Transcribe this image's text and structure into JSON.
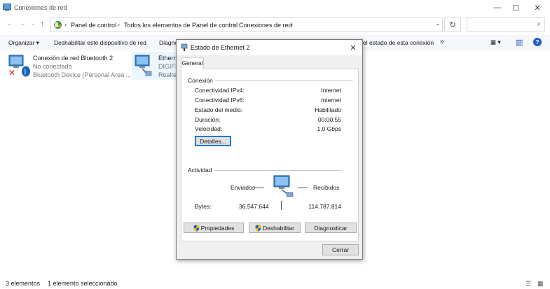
{
  "window": {
    "title": "Conexiones de red",
    "controls": {
      "minimize": "—",
      "maximize": "☐",
      "close": "✕"
    }
  },
  "address": {
    "back": "←",
    "forward": "→",
    "up": "↑",
    "crumbs": [
      "Panel de control",
      "Todos los elementos de Panel de control",
      "Conexiones de red"
    ],
    "separator": "›",
    "dropdown": "⌄",
    "refresh": "↻",
    "search_icon": "⌕"
  },
  "toolbar": {
    "organize": "Organizar ▾",
    "disable": "Deshabilitar este dispositivo de red",
    "diagnose_partial": "Diagno",
    "status_partial": "el estado de esta conexión",
    "more": "»",
    "view": "▦ ▾",
    "pane": "▥",
    "help": "?"
  },
  "connections": [
    {
      "name": "Conexión de red Bluetooth 2",
      "state": "No conectado",
      "device": "Bluetooth Device (Personal Area ..."
    },
    {
      "name": "Etherne",
      "state": "DIGIFIE",
      "device": "Realtek"
    }
  ],
  "statusbar": {
    "count": "3 elementos",
    "selected": "1 elemento seleccionado"
  },
  "dialog": {
    "title": "Estado de Ethernet 2",
    "close": "✕",
    "tab": "General",
    "connection": {
      "heading": "Conexión",
      "rows": [
        {
          "label": "Conectividad IPv4:",
          "value": "Internet"
        },
        {
          "label": "Conectividad IPv6:",
          "value": "Internet"
        },
        {
          "label": "Estado del medio:",
          "value": "Habilitado"
        },
        {
          "label": "Duración:",
          "value": "00:00:55"
        },
        {
          "label": "Velocidad:",
          "value": "1,0 Gbps"
        }
      ],
      "details_button": "Detalles..."
    },
    "activity": {
      "heading": "Actividad",
      "sent_label": "Enviados",
      "received_label": "Recibidos",
      "bytes_label": "Bytes:",
      "bytes_sent": "36.547.644",
      "bytes_received": "114.787.814"
    },
    "buttons": {
      "properties": "Propiedades",
      "disable": "Deshabilitar",
      "diagnose": "Diagnosticar",
      "close": "Cerrar"
    }
  },
  "colors": {
    "accent": "#0078d7",
    "shield_blue": "#1f5fbf",
    "shield_yellow": "#f2c200",
    "error_red": "#d81e06",
    "bluetooth_blue": "#1565c0"
  }
}
